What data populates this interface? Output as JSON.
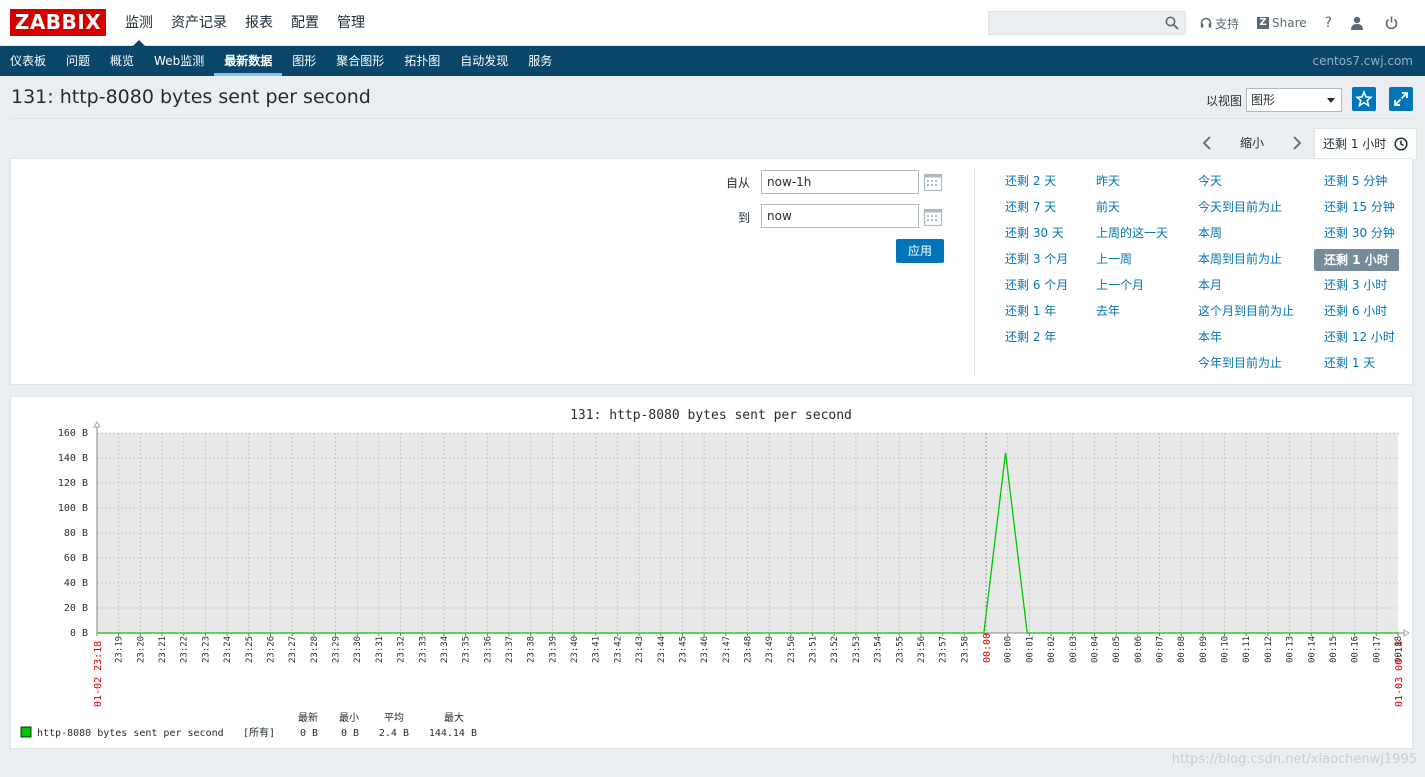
{
  "app": {
    "logo": "ZABBIX",
    "main_menu": [
      "监测",
      "资产记录",
      "报表",
      "配置",
      "管理"
    ],
    "main_menu_active": 0,
    "search": {
      "value": "",
      "placeholder": ""
    },
    "tools": {
      "support": "支持",
      "share": "Share",
      "help": "?",
      "profile": "",
      "logout": ""
    },
    "sub_menu": [
      "仪表板",
      "问题",
      "概览",
      "Web监测",
      "最新数据",
      "图形",
      "聚合图形",
      "拓扑图",
      "自动发现",
      "服务"
    ],
    "sub_menu_active": 4,
    "server_name": "centos7.cwj.com"
  },
  "header": {
    "title": "131: http-8080 bytes sent per second",
    "view_as_label": "以视图",
    "view_as_value": "图形"
  },
  "time_tabs": {
    "zoom_out": "缩小",
    "active": "还剩 1 小时"
  },
  "filter": {
    "from_label": "自从",
    "from_value": "now-1h",
    "to_label": "到",
    "to_value": "now",
    "apply": "应用",
    "quick_columns": [
      [
        "还剩 2 天",
        "还剩 7 天",
        "还剩 30 天",
        "还剩 3 个月",
        "还剩 6 个月",
        "还剩 1 年",
        "还剩 2 年"
      ],
      [
        "昨天",
        "前天",
        "上周的这一天",
        "上一周",
        "上一个月",
        "去年"
      ],
      [
        "今天",
        "今天到目前为止",
        "本周",
        "本周到目前为止",
        "本月",
        "这个月到目前为止",
        "本年",
        "今年到目前为止"
      ],
      [
        "还剩 5 分钟",
        "还剩 15 分钟",
        "还剩 30 分钟",
        "还剩 1 小时",
        "还剩 3 小时",
        "还剩 6 小时",
        "还剩 12 小时",
        "还剩 1 天"
      ]
    ],
    "selected": "还剩 1 小时"
  },
  "chart_data": {
    "type": "line",
    "title": "131: http-8080 bytes sent per second",
    "ylim": [
      0,
      160
    ],
    "y_ticks": [
      "0 B",
      "20 B",
      "40 B",
      "60 B",
      "80 B",
      "100 B",
      "120 B",
      "140 B",
      "160 B"
    ],
    "x_ticks": [
      "23:19",
      "23:20",
      "23:21",
      "23:22",
      "23:23",
      "23:24",
      "23:25",
      "23:26",
      "23:27",
      "23:28",
      "23:29",
      "23:30",
      "23:31",
      "23:32",
      "23:33",
      "23:34",
      "23:35",
      "23:36",
      "23:37",
      "23:38",
      "23:39",
      "23:40",
      "23:41",
      "23:42",
      "23:43",
      "23:44",
      "23:45",
      "23:46",
      "23:47",
      "23:48",
      "23:49",
      "23:50",
      "23:51",
      "23:52",
      "23:53",
      "23:54",
      "23:55",
      "23:56",
      "23:57",
      "23:58",
      "23:59",
      "00:00",
      "00:01",
      "00:02",
      "00:03",
      "00:04",
      "00:05",
      "00:06",
      "00:07",
      "00:08",
      "00:09",
      "00:10",
      "00:11",
      "00:12",
      "00:13",
      "00:14",
      "00:15",
      "00:16",
      "00:17",
      "00:18"
    ],
    "x_start_label": "01-02 23:18",
    "x_end_label": "01-03 00:18",
    "x_midnight_label": "00:00",
    "x_range_minutes": [
      0,
      60
    ],
    "series": [
      {
        "name": "http-8080 bytes sent per second",
        "color": "#00c800",
        "points": [
          [
            0,
            0
          ],
          [
            40.9,
            0
          ],
          [
            41.9,
            144.14
          ],
          [
            42.9,
            0
          ],
          [
            60,
            0
          ]
        ]
      }
    ],
    "legend": {
      "headers": [
        "最新",
        "最小",
        "平均",
        "最大"
      ],
      "item_label": "http-8080 bytes sent per second",
      "func": "[所有]",
      "last": "0 B",
      "min": "0 B",
      "avg": "2.4 B",
      "max": "144.14 B"
    }
  },
  "watermark": "https://blog.csdn.net/xiaochenwj1995"
}
